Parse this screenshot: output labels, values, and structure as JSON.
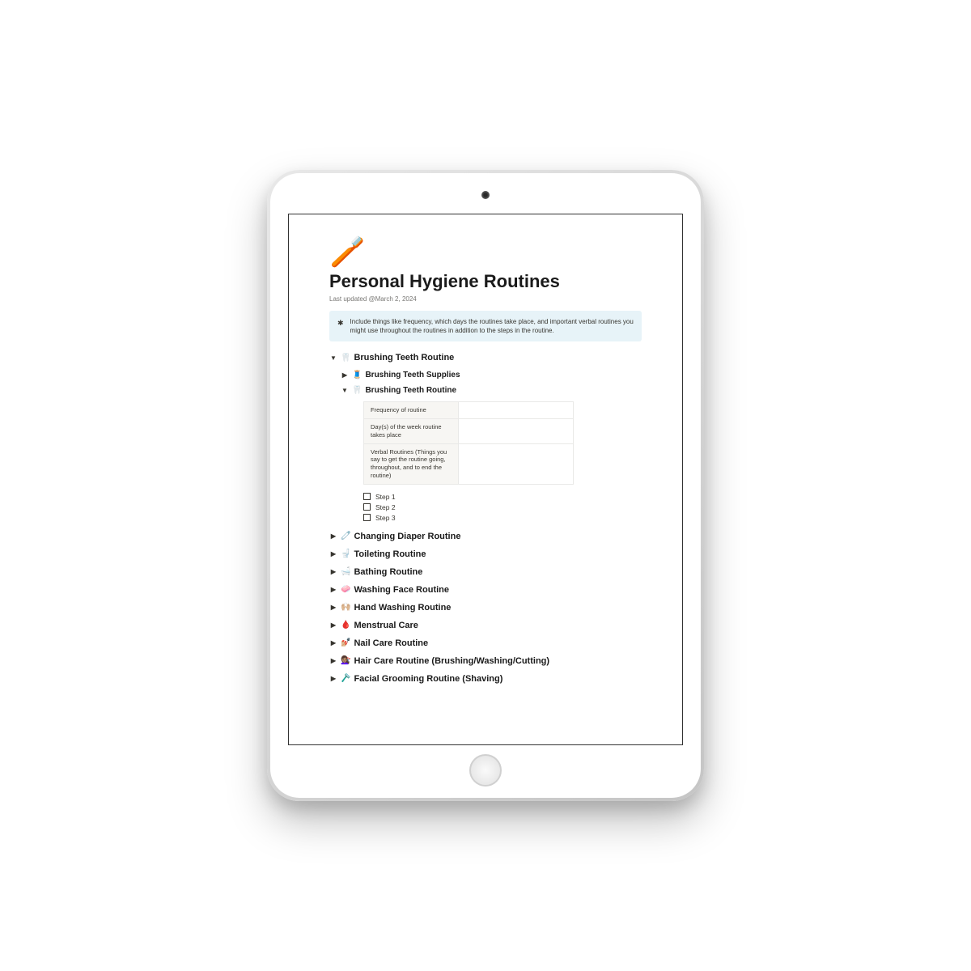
{
  "page": {
    "icon": "🪥",
    "title": "Personal Hygiene Routines",
    "last_updated_label": "Last updated ",
    "last_updated_date": "@March 2, 2024"
  },
  "callout": {
    "icon": "✱",
    "text": "Include things like frequency, which days the routines take place, and important verbal routines you might use throughout the routines in addition to the steps in the routine."
  },
  "brushing": {
    "title": "Brushing Teeth Routine",
    "emoji": "🦷",
    "supplies": {
      "title": "Brushing Teeth Supplies",
      "emoji": "🧵"
    },
    "routine": {
      "title": "Brushing Teeth Routine",
      "emoji": "🦷"
    }
  },
  "table": {
    "row1": "Frequency of routine",
    "row2": "Day(s) of the week routine takes place",
    "row3": "Verbal Routines (Things you say to get the routine going, throughout, and to end the routine)"
  },
  "steps": {
    "s1": "Step 1",
    "s2": "Step 2",
    "s3": "Step 3"
  },
  "sections": [
    {
      "emoji": "🧷",
      "title": "Changing Diaper Routine"
    },
    {
      "emoji": "🚽",
      "title": "Toileting Routine"
    },
    {
      "emoji": "🛁",
      "title": "Bathing Routine"
    },
    {
      "emoji": "🧼",
      "title": "Washing Face Routine"
    },
    {
      "emoji": "🙌🏼",
      "title": "Hand Washing Routine"
    },
    {
      "emoji": "🩸",
      "title": "Menstrual Care"
    },
    {
      "emoji": "💅🏼",
      "title": "Nail Care Routine"
    },
    {
      "emoji": "💇🏽‍♀️",
      "title": "Hair Care Routine (Brushing/Washing/Cutting)"
    },
    {
      "emoji": "🪒",
      "title": "Facial Grooming Routine (Shaving)"
    }
  ]
}
